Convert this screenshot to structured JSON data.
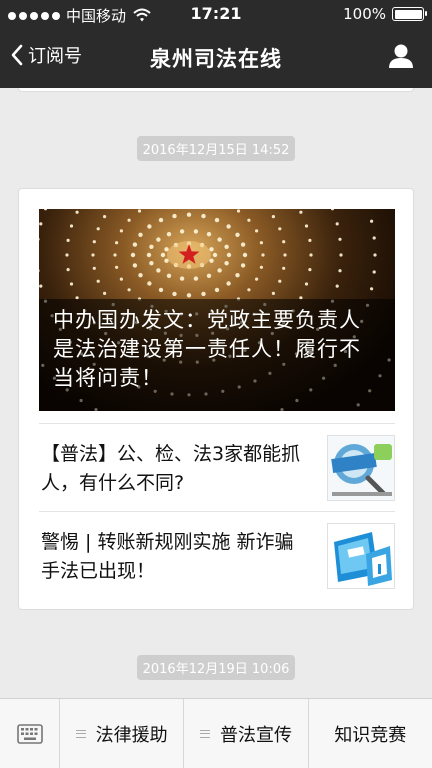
{
  "status_bar": {
    "carrier": "中国移动",
    "time": "17:21",
    "battery_text": "100%",
    "battery_level": 1.0,
    "signal_icon": "signal-dots-icon",
    "wifi_icon": "wifi-icon"
  },
  "nav": {
    "back_label": "订阅号",
    "title": "泉州司法在线",
    "profile_icon": "person-icon"
  },
  "feed": {
    "timestamps": [
      "2016年12月15日 14:52",
      "2016年12月19日 10:06"
    ],
    "card": {
      "cover_title": "中办国办发文：党政主要负责人是法治建设第一责任人！履行不当将问责！",
      "items": [
        {
          "title": "【普法】公、检、法3家都能抓人，有什么不同?",
          "thumb_icon": "law-promo-thumbnail"
        },
        {
          "title": "警惕 | 转账新规刚实施 新诈骗手法已出现！",
          "thumb_icon": "atm-24-thumbnail"
        }
      ]
    }
  },
  "tabbar": {
    "keyboard_icon": "keyboard-icon",
    "menus": [
      "法律援助",
      "普法宣传",
      "知识竞赛"
    ]
  },
  "colors": {
    "bar_bg": "#2b2b2b",
    "page_bg": "#ebebeb",
    "timestamp_bg": "#cecece"
  }
}
